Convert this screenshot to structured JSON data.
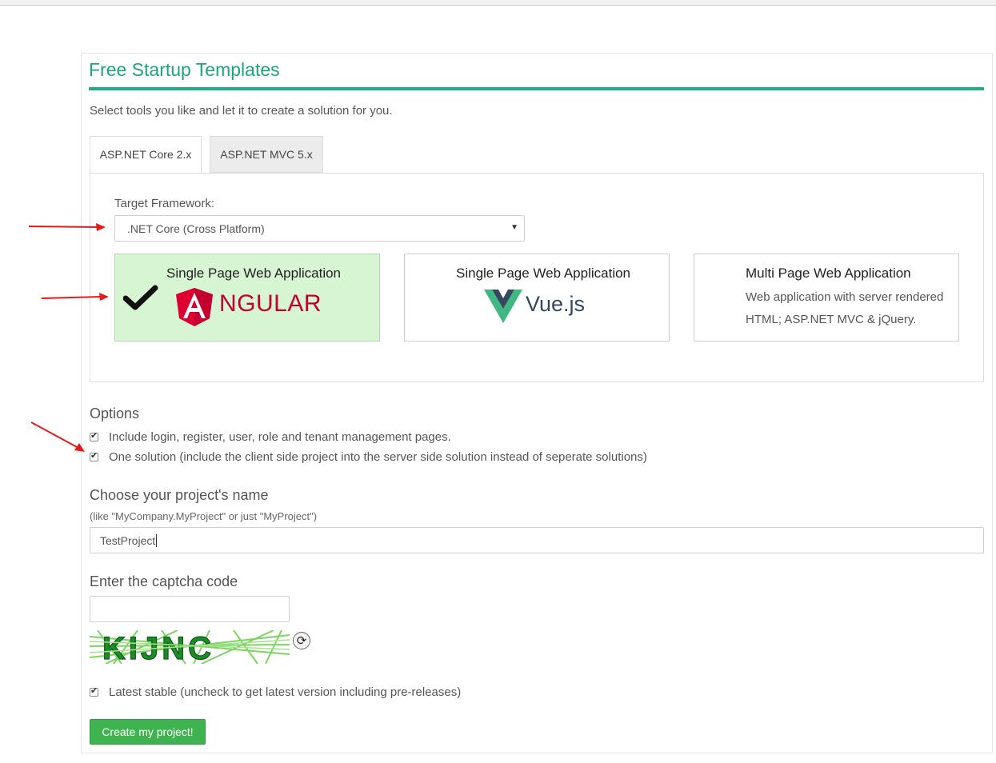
{
  "page": {
    "title": "Free Startup Templates",
    "subtitle": "Select tools you like and let it to create a solution for you."
  },
  "tabs": [
    {
      "label": "ASP.NET Core 2.x",
      "active": true
    },
    {
      "label": "ASP.NET MVC 5.x",
      "active": false
    }
  ],
  "framework": {
    "label": "Target Framework:",
    "selected": ".NET Core (Cross Platform)"
  },
  "templates": [
    {
      "title": "Single Page Web Application",
      "logo_text": "NGULAR",
      "logo_icon": "angular-logo",
      "selected": true
    },
    {
      "title": "Single Page Web Application",
      "logo_text": "Vue.js",
      "logo_icon": "vue-logo",
      "selected": false
    },
    {
      "title": "Multi Page Web Application",
      "description": "Web application with server rendered HTML; ASP.NET MVC & jQuery.",
      "selected": false
    }
  ],
  "options": {
    "title": "Options",
    "items": [
      {
        "label": "Include login, register, user, role and tenant management pages.",
        "checked": true
      },
      {
        "label": "One solution (include the client side project into the server side solution instead of seperate solutions)",
        "checked": true
      }
    ]
  },
  "project": {
    "heading": "Choose your project's name",
    "hint": "(like \"MyCompany.MyProject\" or just \"MyProject\")",
    "value": "TestProject"
  },
  "captcha": {
    "heading": "Enter the captcha code",
    "value": "",
    "image_text": "KIJNC",
    "refresh_icon": "refresh-icon"
  },
  "latest_stable": {
    "label": "Latest stable (uncheck to get latest version including pre-releases)",
    "checked": true
  },
  "submit": {
    "label": "Create my project!"
  },
  "colors": {
    "accent": "#1aa57c",
    "selected_card": "#d7f5d2",
    "button": "#3eb34f",
    "annotation_arrow": "#e31b1b"
  }
}
